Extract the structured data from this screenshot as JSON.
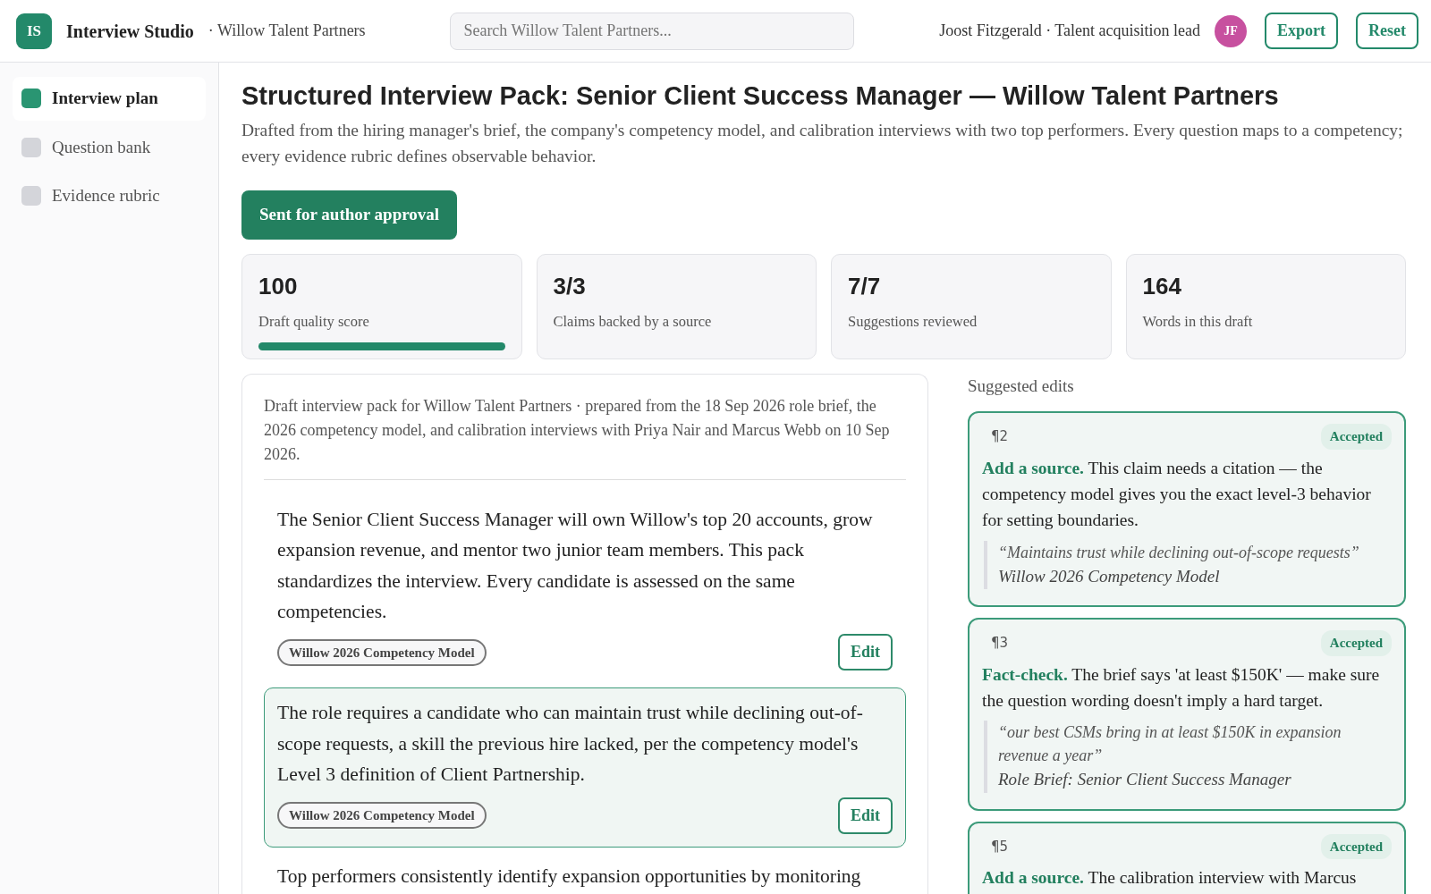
{
  "app": {
    "logo": "IS",
    "name": "Interview Studio",
    "workspace": "· Willow Talent Partners"
  },
  "search": {
    "placeholder": "Search Willow Talent Partners..."
  },
  "user": {
    "name": "Joost Fitzgerald · Talent acquisition lead",
    "initials": "JF",
    "color": "#c7509f"
  },
  "header_buttons": [
    "Export",
    "Reset"
  ],
  "sidebar": {
    "items": [
      {
        "label": "Interview plan",
        "selected": true
      },
      {
        "label": "Question bank",
        "selected": false
      },
      {
        "label": "Evidence rubric",
        "selected": false
      }
    ]
  },
  "page": {
    "title": "Structured Interview Pack: Senior Client Success Manager — Willow Talent Partners",
    "subtitle": "Drafted from the hiring manager's brief, the company's competency model, and calibration interviews with two top performers. Every question maps to a competency; every evidence rubric defines observable behavior.",
    "status_button": "Sent for author approval"
  },
  "stats": [
    {
      "value": "100",
      "label": "Draft quality score",
      "level": 1
    },
    {
      "value": "3/3",
      "label": "Claims backed by a source"
    },
    {
      "value": "7/7",
      "label": "Suggestions reviewed"
    },
    {
      "value": "164",
      "label": "Words in this draft"
    }
  ],
  "draft": {
    "intro": "Draft interview pack for Willow Talent Partners · prepared from the 18 Sep 2026 role brief, the 2026 competency model, and calibration interviews with Priya Nair and Marcus Webb on 10 Sep 2026.",
    "paragraphs": [
      {
        "text": "The Senior Client Success Manager will own Willow's top 20 accounts, grow expansion revenue, and mentor two junior team members. This pack standardizes the interview. Every candidate is assessed on the same competencies.",
        "source": "Willow 2026 Competency Model",
        "action": "Edit",
        "selected": false
      },
      {
        "text": "The role requires a candidate who can maintain trust while declining out-of-scope requests, a skill the previous hire lacked, per the competency model's Level 3 definition of Client Partnership.",
        "source": "Willow 2026 Competency Model",
        "action": "Edit",
        "selected": true
      },
      {
        "text": "Top performers consistently identify expansion opportunities by monitoring",
        "selected": false
      }
    ]
  },
  "suggestions": {
    "title": "Suggested edits",
    "items": [
      {
        "paragraph": "¶2",
        "status": "Accepted",
        "label": "Add a source.",
        "text": "This claim needs a citation — the competency model gives you the exact level-3 behavior for setting boundaries.",
        "quote": "“Maintains trust while declining out-of-scope requests”",
        "source": "Willow 2026 Competency Model"
      },
      {
        "paragraph": "¶3",
        "status": "Accepted",
        "label": "Fact-check.",
        "text": "The brief says 'at least $150K' — make sure the question wording doesn't imply a hard target.",
        "quote": "“our best CSMs bring in at least $150K in expansion revenue a year”",
        "source": "Role Brief: Senior Client Success Manager"
      },
      {
        "paragraph": "¶5",
        "status": "Accepted",
        "label": "Add a source.",
        "text": "The calibration interview with Marcus"
      }
    ]
  }
}
